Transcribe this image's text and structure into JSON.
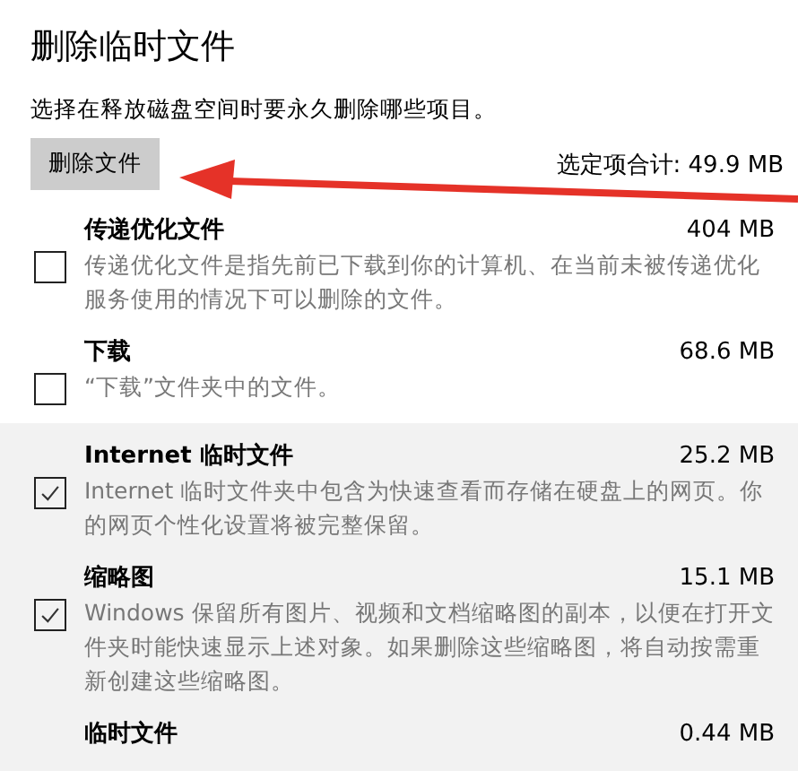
{
  "title": "删除临时文件",
  "subtitle": "选择在释放磁盘空间时要永久删除哪些项目。",
  "delete_button": "删除文件",
  "total": "选定项合计: 49.9 MB",
  "items": [
    {
      "name": "传递优化文件",
      "size": "404 MB",
      "description": "传递优化文件是指先前已下载到你的计算机、在当前未被传递优化服务使用的情况下可以删除的文件。",
      "checked": false,
      "highlighted": false
    },
    {
      "name": "下载",
      "size": "68.6 MB",
      "description": "“下载”文件夹中的文件。",
      "checked": false,
      "highlighted": false
    },
    {
      "name": "Internet 临时文件",
      "size": "25.2 MB",
      "description": "Internet 临时文件夹中包含为快速查看而存储在硬盘上的网页。你的网页个性化设置将被完整保留。",
      "checked": true,
      "highlighted": true
    },
    {
      "name": "缩略图",
      "size": "15.1 MB",
      "description": "Windows 保留所有图片、视频和文档缩略图的副本，以便在打开文件夹时能快速显示上述对象。如果删除这些缩略图，将自动按需重新创建这些缩略图。",
      "checked": true,
      "highlighted": true
    },
    {
      "name": "临时文件",
      "size": "0.44 MB",
      "highlighted": true
    }
  ]
}
